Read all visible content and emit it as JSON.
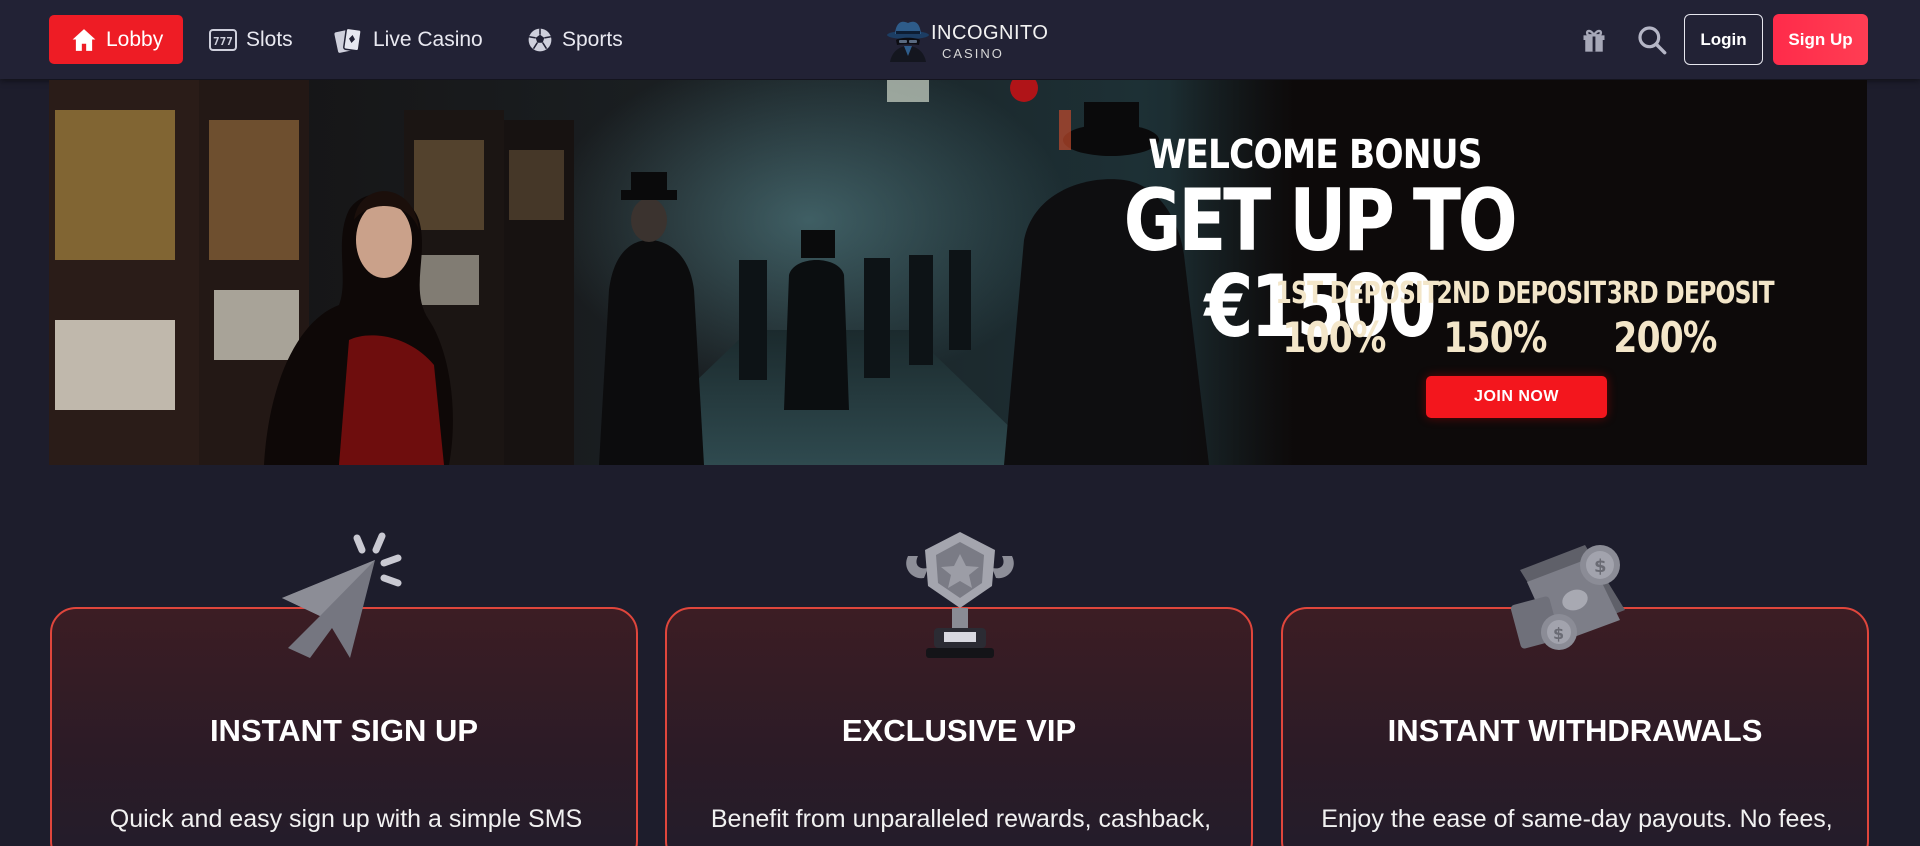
{
  "header": {
    "nav": [
      {
        "label": "Lobby",
        "icon": "home-icon",
        "active": true
      },
      {
        "label": "Slots",
        "icon": "slot-machine-icon",
        "active": false
      },
      {
        "label": "Live Casino",
        "icon": "playing-cards-icon",
        "active": false
      },
      {
        "label": "Sports",
        "icon": "soccer-ball-icon",
        "active": false
      }
    ],
    "logo": {
      "title": "INCOGNITO",
      "subtitle": "CASINO"
    },
    "actions": {
      "gift_icon": "gift-icon",
      "search_icon": "search-icon",
      "login_label": "Login",
      "signup_label": "Sign Up"
    }
  },
  "banner": {
    "welcome": "WELCOME BONUS",
    "headline": "GET UP TO €1500",
    "deposits": [
      {
        "label": "1ST DEPOSIT",
        "percent": "100%"
      },
      {
        "label": "2ND DEPOSIT",
        "percent": "150%"
      },
      {
        "label": "3RD DEPOSIT",
        "percent": "200%"
      }
    ],
    "cta": "JOIN NOW"
  },
  "features": [
    {
      "title": "INSTANT SIGN UP",
      "description": "Quick and easy sign up with a simple SMS",
      "icon": "cursor-click-icon"
    },
    {
      "title": "EXCLUSIVE VIP",
      "description": "Benefit from unparalleled rewards, cashback,",
      "icon": "trophy-icon"
    },
    {
      "title": "INSTANT WITHDRAWALS",
      "description": "Enjoy the ease of same-day payouts. No fees,",
      "icon": "money-coins-icon"
    }
  ],
  "colors": {
    "page_bg": "#1d1d2c",
    "header_bg": "#222235",
    "accent_red": "#ee1c25",
    "signup_red": "#ff2b4a",
    "card_border": "#e0463c"
  }
}
